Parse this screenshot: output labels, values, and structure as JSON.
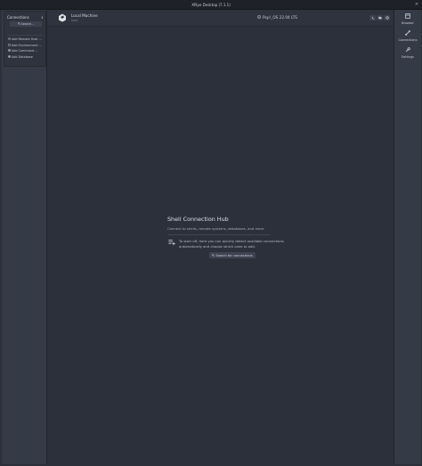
{
  "window": {
    "title": "XPipe Desktop (7.1.1)",
    "close_symbol": "✕"
  },
  "sidebar": {
    "connections_label": "Connections",
    "info_symbol": "ℹ",
    "search_label": "Search...",
    "add_items": [
      {
        "label": "Add Remote Host ...",
        "icon": "host-icon"
      },
      {
        "label": "Add Environment ...",
        "icon": "environment-icon"
      },
      {
        "label": "Add Command ...",
        "icon": "command-icon"
      },
      {
        "label": "Add Database",
        "icon": "database-icon"
      }
    ]
  },
  "topbar": {
    "machine_title": "Local Machine",
    "machine_subtitle": "bash",
    "os_label": "Pop!_OS 22.04 LTS"
  },
  "hub": {
    "title": "Shell Connection Hub",
    "description": "Connect to shells, remote systems, databases, and more.",
    "tip_text": "To start off, here you can quickly detect available connections automatically and choose which ones to add.",
    "search_button": "Search for connections"
  },
  "rightbar": {
    "items": [
      {
        "label": "Browser",
        "icon": "browser-icon"
      },
      {
        "label": "Connections",
        "icon": "connections-icon"
      },
      {
        "label": "Settings",
        "icon": "settings-icon"
      }
    ]
  }
}
